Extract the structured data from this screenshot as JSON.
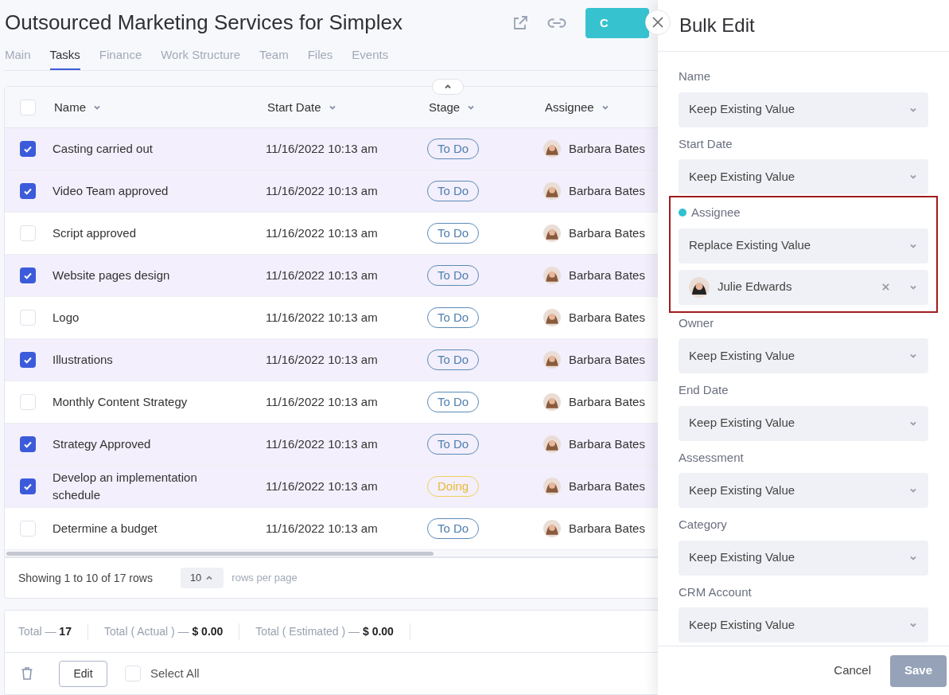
{
  "header": {
    "title": "Outsourced Marketing Services for Simplex",
    "action_button": "C"
  },
  "tabs": [
    {
      "label": "Main",
      "selected": false
    },
    {
      "label": "Tasks",
      "selected": true
    },
    {
      "label": "Finance",
      "selected": false
    },
    {
      "label": "Work Structure",
      "selected": false
    },
    {
      "label": "Team",
      "selected": false
    },
    {
      "label": "Files",
      "selected": false
    },
    {
      "label": "Events",
      "selected": false
    }
  ],
  "table": {
    "all_checked": false,
    "columns": [
      "Name",
      "Start Date",
      "Stage",
      "Assignee"
    ],
    "rows": [
      {
        "selected": true,
        "name": "Casting carried out",
        "start_date": "11/16/2022 10:13 am",
        "stage": {
          "label": "To Do",
          "kind": "todo"
        },
        "assignee": "Barbara Bates"
      },
      {
        "selected": true,
        "name": "Video Team approved",
        "start_date": "11/16/2022 10:13 am",
        "stage": {
          "label": "To Do",
          "kind": "todo"
        },
        "assignee": "Barbara Bates"
      },
      {
        "selected": false,
        "name": "Script approved",
        "start_date": "11/16/2022 10:13 am",
        "stage": {
          "label": "To Do",
          "kind": "todo"
        },
        "assignee": "Barbara Bates"
      },
      {
        "selected": true,
        "name": "Website pages design",
        "start_date": "11/16/2022 10:13 am",
        "stage": {
          "label": "To Do",
          "kind": "todo"
        },
        "assignee": "Barbara Bates"
      },
      {
        "selected": false,
        "name": "Logo",
        "start_date": "11/16/2022 10:13 am",
        "stage": {
          "label": "To Do",
          "kind": "todo"
        },
        "assignee": "Barbara Bates"
      },
      {
        "selected": true,
        "name": "Illustrations",
        "start_date": "11/16/2022 10:13 am",
        "stage": {
          "label": "To Do",
          "kind": "todo"
        },
        "assignee": "Barbara Bates"
      },
      {
        "selected": false,
        "name": "Monthly Content Strategy",
        "start_date": "11/16/2022 10:13 am",
        "stage": {
          "label": "To Do",
          "kind": "todo"
        },
        "assignee": "Barbara Bates"
      },
      {
        "selected": true,
        "name": "Strategy Approved",
        "start_date": "11/16/2022 10:13 am",
        "stage": {
          "label": "To Do",
          "kind": "todo"
        },
        "assignee": "Barbara Bates"
      },
      {
        "selected": true,
        "name": "Develop an implementation schedule",
        "start_date": "11/16/2022 10:13 am",
        "stage": {
          "label": "Doing",
          "kind": "doing"
        },
        "assignee": "Barbara Bates"
      },
      {
        "selected": false,
        "name": "Determine a budget",
        "start_date": "11/16/2022 10:13 am",
        "stage": {
          "label": "To Do",
          "kind": "todo"
        },
        "assignee": "Barbara Bates"
      }
    ]
  },
  "pagination": {
    "summary": "Showing 1 to 10 of 17 rows",
    "page_size": "10",
    "page_size_label": "rows per page"
  },
  "totals": [
    {
      "label": "Total —",
      "value": "17"
    },
    {
      "label": "Total ( Actual ) —",
      "value": "$ 0.00"
    },
    {
      "label": "Total ( Estimated ) —",
      "value": "$ 0.00"
    }
  ],
  "actions": {
    "edit": "Edit",
    "select_all": "Select All",
    "select_all_checked": false
  },
  "bulk_edit": {
    "title": "Bulk Edit",
    "fields": [
      {
        "label": "Name",
        "value": "Keep Existing Value",
        "highlighted": false
      },
      {
        "label": "Start Date",
        "value": "Keep Existing Value",
        "highlighted": false
      },
      {
        "label": "Assignee",
        "value": "Replace Existing Value",
        "highlighted": true,
        "person": "Julie Edwards"
      },
      {
        "label": "Owner",
        "value": "Keep Existing Value",
        "highlighted": false
      },
      {
        "label": "End Date",
        "value": "Keep Existing Value",
        "highlighted": false
      },
      {
        "label": "Assessment",
        "value": "Keep Existing Value",
        "highlighted": false
      },
      {
        "label": "Category",
        "value": "Keep Existing Value",
        "highlighted": false
      },
      {
        "label": "CRM Account",
        "value": "Keep Existing Value",
        "highlighted": false
      }
    ],
    "cancel": "Cancel",
    "save": "Save"
  }
}
